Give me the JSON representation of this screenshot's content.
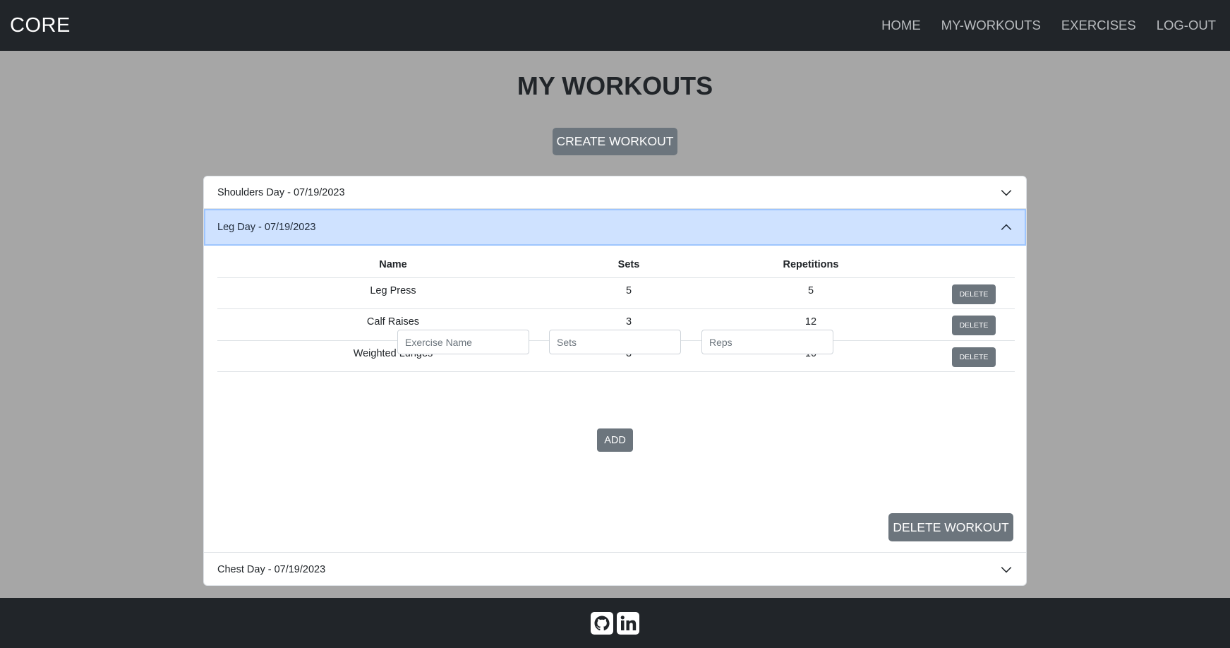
{
  "navbar": {
    "brand": "CORE",
    "links": [
      "HOME",
      "MY-WORKOUTS",
      "EXERCISES",
      "LOG-OUT"
    ]
  },
  "page": {
    "title": "MY WORKOUTS",
    "create_button": "CREATE WORKOUT"
  },
  "workouts": [
    {
      "title": "Shoulders Day - 07/19/2023",
      "expanded": false
    },
    {
      "title": "Leg Day - 07/19/2023",
      "expanded": true
    },
    {
      "title": "Chest Day - 07/19/2023",
      "expanded": false
    }
  ],
  "table": {
    "headers": [
      "Name",
      "Sets",
      "Repetitions"
    ],
    "rows": [
      {
        "name": "Leg Press",
        "sets": "5",
        "reps": "5",
        "action": "DELETE"
      },
      {
        "name": "Calf Raises",
        "sets": "3",
        "reps": "12",
        "action": "DELETE"
      },
      {
        "name": "Weighted Lunges",
        "sets": "3",
        "reps": "10",
        "action": "DELETE"
      }
    ]
  },
  "form": {
    "name_placeholder": "Exercise Name",
    "sets_placeholder": "Sets",
    "reps_placeholder": "Reps",
    "add_label": "ADD"
  },
  "delete_workout_label": "DELETE WORKOUT",
  "footer": {
    "icons": [
      "github-icon",
      "linkedin-icon"
    ]
  },
  "colors": {
    "navbar_bg": "#212529",
    "page_bg": "#a6a6a6",
    "button_bg": "#6c757d",
    "active_header_bg": "#cfe2ff"
  }
}
